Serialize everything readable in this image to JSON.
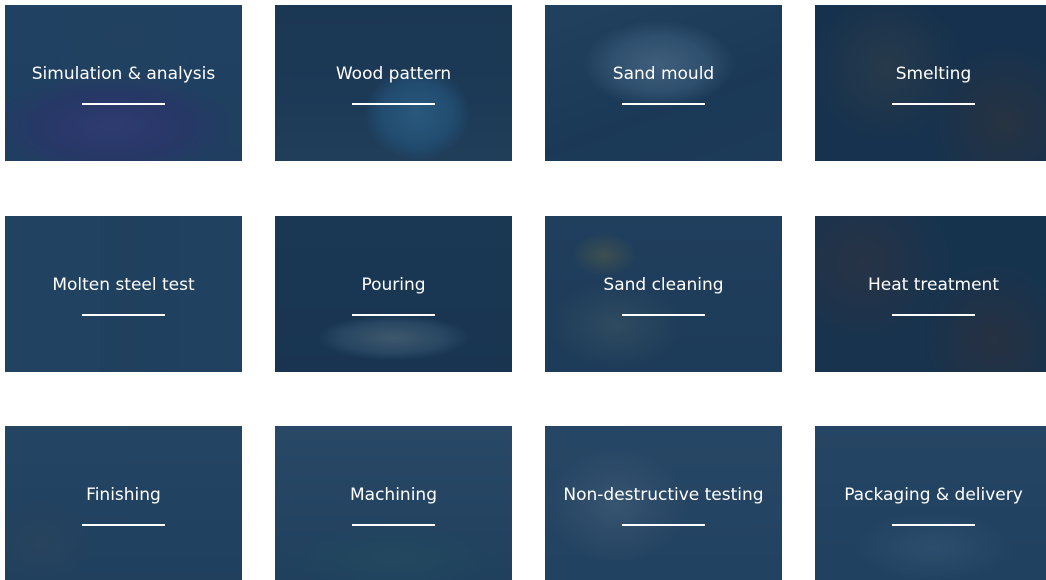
{
  "process_cards": [
    {
      "title": "Simulation & analysis"
    },
    {
      "title": "Wood pattern"
    },
    {
      "title": "Sand mould"
    },
    {
      "title": "Smelting"
    },
    {
      "title": "Molten steel test"
    },
    {
      "title": "Pouring"
    },
    {
      "title": "Sand cleaning"
    },
    {
      "title": "Heat treatment"
    },
    {
      "title": "Finishing"
    },
    {
      "title": "Machining"
    },
    {
      "title": "Non-destructive testing"
    },
    {
      "title": "Packaging & delivery"
    }
  ],
  "colors": {
    "overlay": "#183a5c",
    "text": "#ffffff",
    "background": "#ffffff"
  }
}
